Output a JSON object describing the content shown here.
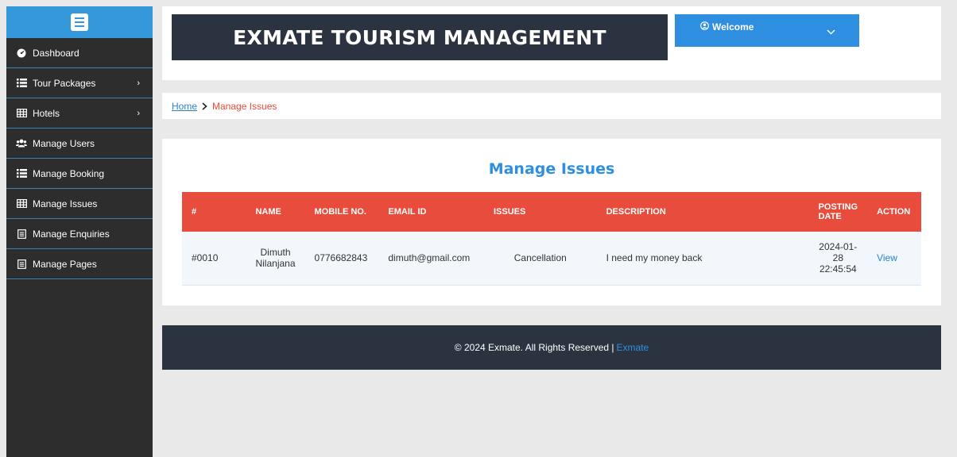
{
  "sidebar": {
    "toggle_icon": "menu-icon",
    "items": [
      {
        "label": "Dashboard",
        "icon": "dashboard-icon",
        "has_arrow": false
      },
      {
        "label": "Tour Packages",
        "icon": "list-icon",
        "has_arrow": true
      },
      {
        "label": "Hotels",
        "icon": "table-icon",
        "has_arrow": true
      },
      {
        "label": "Manage Users",
        "icon": "users-icon",
        "has_arrow": false
      },
      {
        "label": "Manage Booking",
        "icon": "list-icon",
        "has_arrow": false
      },
      {
        "label": "Manage Issues",
        "icon": "table-icon",
        "has_arrow": false
      },
      {
        "label": "Manage Enquiries",
        "icon": "file-icon",
        "has_arrow": false
      },
      {
        "label": "Manage Pages",
        "icon": "file-icon",
        "has_arrow": false
      }
    ]
  },
  "header": {
    "title": "EXMATE TOURISM MANAGEMENT",
    "welcome_label": "Welcome"
  },
  "breadcrumb": {
    "home": "Home",
    "current": "Manage Issues"
  },
  "main": {
    "title": "Manage Issues",
    "columns": [
      "#",
      "NAME",
      "MOBILE NO.",
      "EMAIL ID",
      "ISSUES",
      "DESCRIPTION",
      "POSTING DATE",
      "ACTION"
    ],
    "rows": [
      {
        "id": "#0010",
        "name": "Dimuth Nilanjana",
        "mobile": "0776682843",
        "email": "dimuth@gmail.com",
        "issue": "Cancellation",
        "description": "I need my money back",
        "posting_date": "2024-01-28 22:45:54",
        "action": "View"
      }
    ]
  },
  "footer": {
    "text": "© 2024 Exmate. All Rights Reserved |",
    "link": "Exmate"
  },
  "colors": {
    "sidebar_bg": "#2d2d2d",
    "accent_blue": "#2e8fe0",
    "header_dark": "#2c3340",
    "table_header_red": "#e74c3c"
  }
}
